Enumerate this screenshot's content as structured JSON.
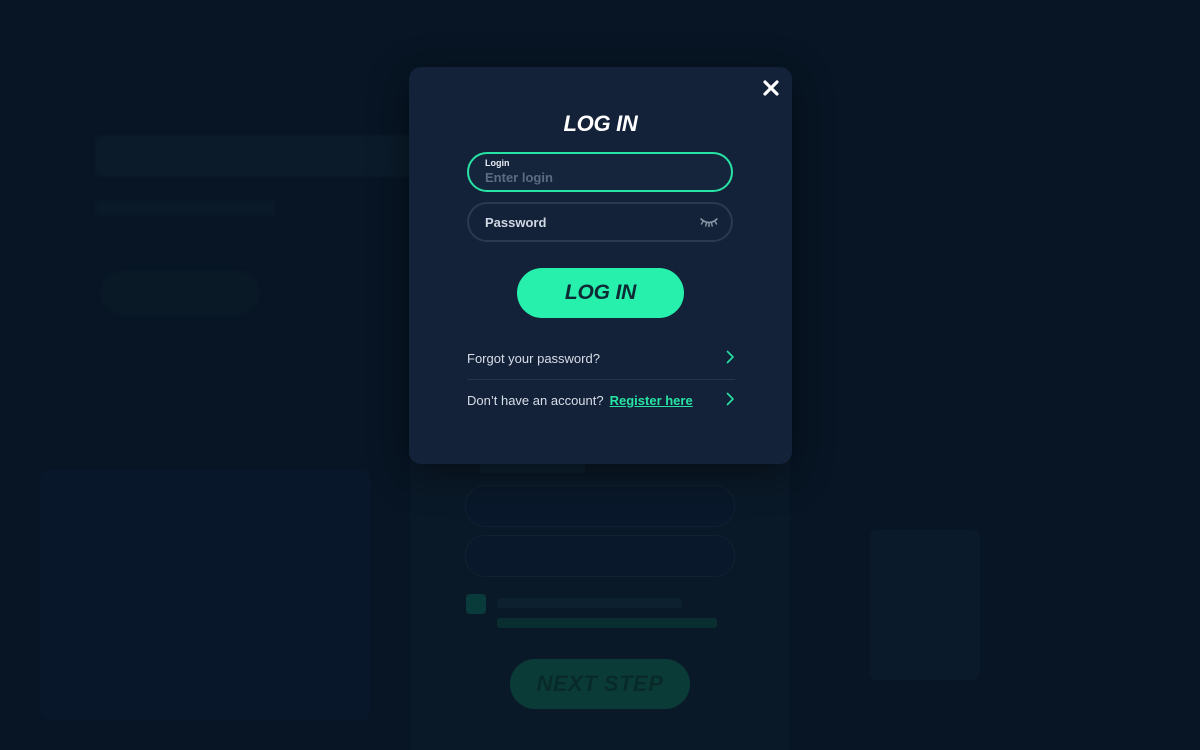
{
  "background": {
    "next_button_label": "NEXT STEP"
  },
  "modal": {
    "title": "LOG IN",
    "login_field": {
      "label": "Login",
      "placeholder": "Enter login"
    },
    "password_field": {
      "placeholder": "Password"
    },
    "submit_label": "LOG IN",
    "forgot_password": "Forgot your password?",
    "no_account": "Don’t have an account?",
    "register_link": "Register here"
  },
  "colors": {
    "accent": "#27f0ad",
    "modal_bg": "#132239",
    "page_bg": "#071524"
  },
  "icons": [
    "close-icon",
    "eye-closed-icon",
    "chevron-right-icon"
  ]
}
